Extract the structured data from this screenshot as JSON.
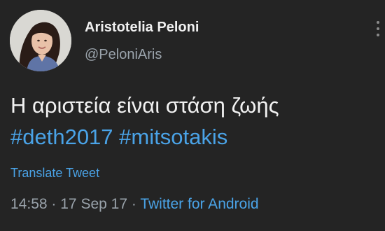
{
  "author": {
    "display_name": "Aristotelia Peloni",
    "handle": "@PeloniAris",
    "avatar_icon": "profile-photo"
  },
  "tweet": {
    "text": "Η αριστεία είναι στάση ζωής",
    "hashtags": [
      "#deth2017",
      "#mitsotakis"
    ],
    "translate_label": "Translate Tweet"
  },
  "meta": {
    "time": "14:58",
    "separator": "·",
    "date": "17 Sep 17",
    "source": "Twitter for Android"
  },
  "colors": {
    "background": "#242424",
    "link": "#4aa3e7",
    "secondary_text": "#9aa3ab",
    "primary_text": "#f2f2f2"
  }
}
